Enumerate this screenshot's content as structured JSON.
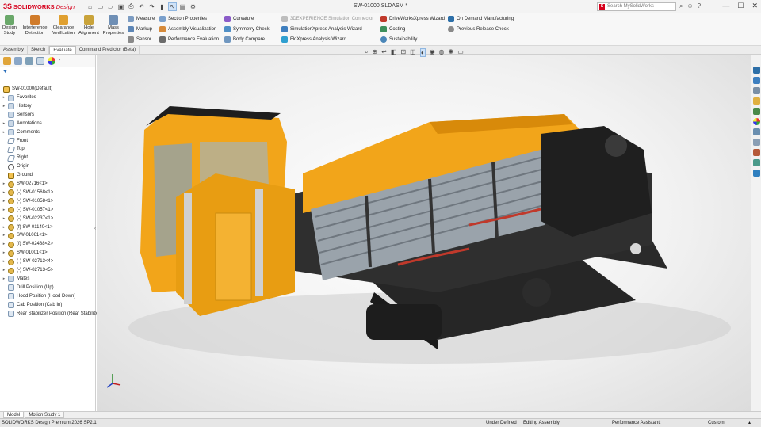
{
  "app": {
    "brand": "SOLIDWORKS",
    "brand_sub": "Design",
    "logo_mark": "3S",
    "document_title": "SW-01000.SLDASM *",
    "search_placeholder": "Search MySolidWorks"
  },
  "quick_access": [
    "home-icon",
    "new-icon",
    "open-icon",
    "save-icon",
    "print-icon",
    "undo-icon",
    "redo-icon",
    "rebuild-icon",
    "select-icon",
    "file-properties-icon",
    "options-icon"
  ],
  "window_controls": {
    "minimize": "—",
    "maximize": "☐",
    "close": "✕"
  },
  "ribbon": {
    "big_buttons": [
      {
        "label1": "Design",
        "label2": "Study",
        "color": "#6aa86a"
      },
      {
        "label1": "Interference",
        "label2": "Detection",
        "color": "#d07b2a"
      },
      {
        "label1": "Clearance",
        "label2": "Verification",
        "color": "#e0a030"
      },
      {
        "label1": "Hole",
        "label2": "Alignment",
        "color": "#c9a33a"
      },
      {
        "label1": "Mass",
        "label2": "Properties",
        "color": "#6f8fb5"
      }
    ],
    "col1": [
      "Measure",
      "Markup",
      "Sensor"
    ],
    "col2": [
      "Section Properties",
      "Assembly Visualization",
      "Performance Evaluation"
    ],
    "col3": [
      "Curvature",
      "Symmetry Check",
      "Body Compare"
    ],
    "col4": [
      "3DEXPERIENCE Simulation Connector",
      "SimulationXpress Analysis Wizard",
      "FloXpress Analysis Wizard"
    ],
    "col5": [
      "DriveWorksXpress Wizard",
      "Costing",
      "Sustainability"
    ],
    "col6": [
      "On Demand Manufacturing",
      "Previous Release Check"
    ]
  },
  "command_tabs": [
    "Assembly",
    "Sketch",
    "Evaluate",
    "Command Predictor (Beta)"
  ],
  "active_command_tab": "Evaluate",
  "feature_tree": {
    "root": "SW-01000(Default)",
    "items": [
      {
        "label": "Favorites",
        "icon": "folder",
        "expand": true
      },
      {
        "label": "History",
        "icon": "folder",
        "expand": true
      },
      {
        "label": "Sensors",
        "icon": "folder",
        "expand": false
      },
      {
        "label": "Annotations",
        "icon": "folder",
        "expand": true
      },
      {
        "label": "Comments",
        "icon": "folder",
        "expand": true
      },
      {
        "label": "Front",
        "icon": "plane",
        "expand": false
      },
      {
        "label": "Top",
        "icon": "plane",
        "expand": false
      },
      {
        "label": "Right",
        "icon": "plane",
        "expand": false
      },
      {
        "label": "Origin",
        "icon": "origin",
        "expand": false
      },
      {
        "label": "Ground",
        "icon": "asm",
        "expand": false
      },
      {
        "label": "SW-02716<1>",
        "icon": "part",
        "expand": true
      },
      {
        "label": "(-) SW-01568<1>",
        "icon": "part",
        "expand": true
      },
      {
        "label": "(-) SW-01058<1>",
        "icon": "part",
        "expand": true
      },
      {
        "label": "(-) SW-01057<1>",
        "icon": "part",
        "expand": true
      },
      {
        "label": "(-) SW-02237<1>",
        "icon": "part",
        "expand": true
      },
      {
        "label": "(f) SW-01140<1>",
        "icon": "part",
        "expand": true
      },
      {
        "label": "SW-01061<1>",
        "icon": "part",
        "expand": true
      },
      {
        "label": "(f) SW-02488<2>",
        "icon": "part",
        "expand": true
      },
      {
        "label": "SW-01001<1>",
        "icon": "part",
        "expand": true
      },
      {
        "label": "(-) SW-02713<4>",
        "icon": "part",
        "expand": true
      },
      {
        "label": "(-) SW-02713<5>",
        "icon": "part",
        "expand": true
      },
      {
        "label": "Mates",
        "icon": "folder",
        "expand": true
      },
      {
        "label": "Drill Position (Up)",
        "icon": "config",
        "expand": false
      },
      {
        "label": "Hood Position (Hood Down)",
        "icon": "config",
        "expand": false
      },
      {
        "label": "Cab Position (Cab In)",
        "icon": "config",
        "expand": false
      },
      {
        "label": "Rear Stabilizer Position (Rear Stabilizer Up)",
        "icon": "config",
        "expand": false
      }
    ]
  },
  "bottom_tabs": [
    "Model",
    "Motion Study 1"
  ],
  "status": {
    "version": "SOLIDWORKS Design Premium 2026 SP2.1",
    "state": "Under Defined",
    "mode": "Editing Assembly",
    "assistant": "Performance Assistant:",
    "units": "Custom"
  },
  "colors": {
    "accent_red": "#d6001c",
    "machine_yellow": "#f2a51a",
    "machine_dark": "#2b2b2b"
  }
}
